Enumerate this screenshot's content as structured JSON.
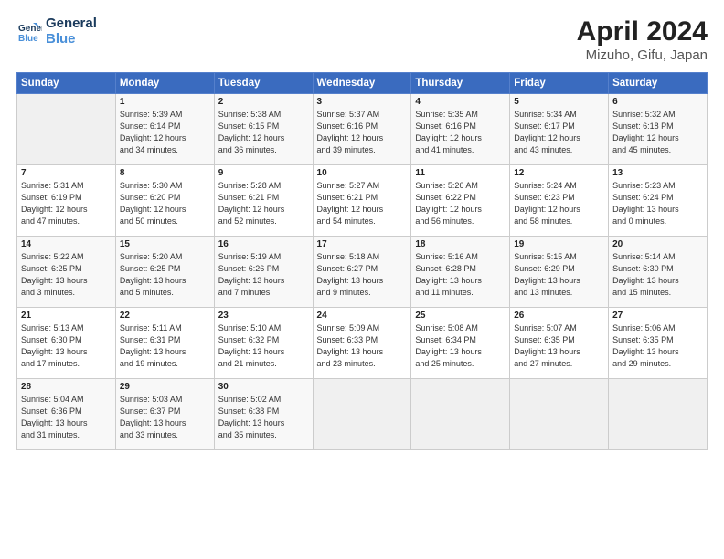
{
  "header": {
    "logo_line1": "General",
    "logo_line2": "Blue",
    "title": "April 2024",
    "subtitle": "Mizuho, Gifu, Japan"
  },
  "days_of_week": [
    "Sunday",
    "Monday",
    "Tuesday",
    "Wednesday",
    "Thursday",
    "Friday",
    "Saturday"
  ],
  "weeks": [
    [
      {
        "num": "",
        "info": ""
      },
      {
        "num": "1",
        "info": "Sunrise: 5:39 AM\nSunset: 6:14 PM\nDaylight: 12 hours\nand 34 minutes."
      },
      {
        "num": "2",
        "info": "Sunrise: 5:38 AM\nSunset: 6:15 PM\nDaylight: 12 hours\nand 36 minutes."
      },
      {
        "num": "3",
        "info": "Sunrise: 5:37 AM\nSunset: 6:16 PM\nDaylight: 12 hours\nand 39 minutes."
      },
      {
        "num": "4",
        "info": "Sunrise: 5:35 AM\nSunset: 6:16 PM\nDaylight: 12 hours\nand 41 minutes."
      },
      {
        "num": "5",
        "info": "Sunrise: 5:34 AM\nSunset: 6:17 PM\nDaylight: 12 hours\nand 43 minutes."
      },
      {
        "num": "6",
        "info": "Sunrise: 5:32 AM\nSunset: 6:18 PM\nDaylight: 12 hours\nand 45 minutes."
      }
    ],
    [
      {
        "num": "7",
        "info": "Sunrise: 5:31 AM\nSunset: 6:19 PM\nDaylight: 12 hours\nand 47 minutes."
      },
      {
        "num": "8",
        "info": "Sunrise: 5:30 AM\nSunset: 6:20 PM\nDaylight: 12 hours\nand 50 minutes."
      },
      {
        "num": "9",
        "info": "Sunrise: 5:28 AM\nSunset: 6:21 PM\nDaylight: 12 hours\nand 52 minutes."
      },
      {
        "num": "10",
        "info": "Sunrise: 5:27 AM\nSunset: 6:21 PM\nDaylight: 12 hours\nand 54 minutes."
      },
      {
        "num": "11",
        "info": "Sunrise: 5:26 AM\nSunset: 6:22 PM\nDaylight: 12 hours\nand 56 minutes."
      },
      {
        "num": "12",
        "info": "Sunrise: 5:24 AM\nSunset: 6:23 PM\nDaylight: 12 hours\nand 58 minutes."
      },
      {
        "num": "13",
        "info": "Sunrise: 5:23 AM\nSunset: 6:24 PM\nDaylight: 13 hours\nand 0 minutes."
      }
    ],
    [
      {
        "num": "14",
        "info": "Sunrise: 5:22 AM\nSunset: 6:25 PM\nDaylight: 13 hours\nand 3 minutes."
      },
      {
        "num": "15",
        "info": "Sunrise: 5:20 AM\nSunset: 6:25 PM\nDaylight: 13 hours\nand 5 minutes."
      },
      {
        "num": "16",
        "info": "Sunrise: 5:19 AM\nSunset: 6:26 PM\nDaylight: 13 hours\nand 7 minutes."
      },
      {
        "num": "17",
        "info": "Sunrise: 5:18 AM\nSunset: 6:27 PM\nDaylight: 13 hours\nand 9 minutes."
      },
      {
        "num": "18",
        "info": "Sunrise: 5:16 AM\nSunset: 6:28 PM\nDaylight: 13 hours\nand 11 minutes."
      },
      {
        "num": "19",
        "info": "Sunrise: 5:15 AM\nSunset: 6:29 PM\nDaylight: 13 hours\nand 13 minutes."
      },
      {
        "num": "20",
        "info": "Sunrise: 5:14 AM\nSunset: 6:30 PM\nDaylight: 13 hours\nand 15 minutes."
      }
    ],
    [
      {
        "num": "21",
        "info": "Sunrise: 5:13 AM\nSunset: 6:30 PM\nDaylight: 13 hours\nand 17 minutes."
      },
      {
        "num": "22",
        "info": "Sunrise: 5:11 AM\nSunset: 6:31 PM\nDaylight: 13 hours\nand 19 minutes."
      },
      {
        "num": "23",
        "info": "Sunrise: 5:10 AM\nSunset: 6:32 PM\nDaylight: 13 hours\nand 21 minutes."
      },
      {
        "num": "24",
        "info": "Sunrise: 5:09 AM\nSunset: 6:33 PM\nDaylight: 13 hours\nand 23 minutes."
      },
      {
        "num": "25",
        "info": "Sunrise: 5:08 AM\nSunset: 6:34 PM\nDaylight: 13 hours\nand 25 minutes."
      },
      {
        "num": "26",
        "info": "Sunrise: 5:07 AM\nSunset: 6:35 PM\nDaylight: 13 hours\nand 27 minutes."
      },
      {
        "num": "27",
        "info": "Sunrise: 5:06 AM\nSunset: 6:35 PM\nDaylight: 13 hours\nand 29 minutes."
      }
    ],
    [
      {
        "num": "28",
        "info": "Sunrise: 5:04 AM\nSunset: 6:36 PM\nDaylight: 13 hours\nand 31 minutes."
      },
      {
        "num": "29",
        "info": "Sunrise: 5:03 AM\nSunset: 6:37 PM\nDaylight: 13 hours\nand 33 minutes."
      },
      {
        "num": "30",
        "info": "Sunrise: 5:02 AM\nSunset: 6:38 PM\nDaylight: 13 hours\nand 35 minutes."
      },
      {
        "num": "",
        "info": ""
      },
      {
        "num": "",
        "info": ""
      },
      {
        "num": "",
        "info": ""
      },
      {
        "num": "",
        "info": ""
      }
    ]
  ]
}
